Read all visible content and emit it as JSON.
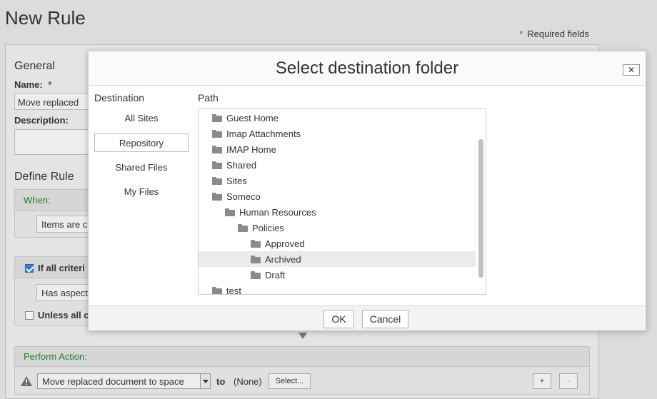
{
  "page": {
    "title": "New Rule",
    "required_note": "Required fields",
    "required_star": "*"
  },
  "general": {
    "heading": "General",
    "name_label": "Name:",
    "name_star": "*",
    "name_value": "Move replaced",
    "description_label": "Description:"
  },
  "define_rule": {
    "heading": "Define Rule",
    "when_label": "When:",
    "when_value": "Items are c",
    "if_all_label": "If all criteri",
    "if_all_checked": true,
    "has_aspect_value": "Has aspect",
    "unless_label": "Unless all c",
    "unless_checked": false
  },
  "perform_action": {
    "label": "Perform Action:",
    "action_value": "Move replaced document to space",
    "to_label": "to",
    "none_label": "(None)",
    "select_button": "Select...",
    "plus_button": "+",
    "minus_button": "-"
  },
  "dialog": {
    "title": "Select destination folder",
    "close_glyph": "✕",
    "destination_label": "Destination",
    "path_label": "Path",
    "sites": [
      {
        "label": "All Sites",
        "selected": false
      },
      {
        "label": "Repository",
        "selected": true
      },
      {
        "label": "Shared Files",
        "selected": false
      },
      {
        "label": "My Files",
        "selected": false
      }
    ],
    "tree": [
      {
        "label": "Guest Home",
        "depth": 0,
        "highlight": false
      },
      {
        "label": "Imap Attachments",
        "depth": 0,
        "highlight": false
      },
      {
        "label": "IMAP Home",
        "depth": 0,
        "highlight": false
      },
      {
        "label": "Shared",
        "depth": 0,
        "highlight": false
      },
      {
        "label": "Sites",
        "depth": 0,
        "highlight": false
      },
      {
        "label": "Someco",
        "depth": 0,
        "highlight": false
      },
      {
        "label": "Human Resources",
        "depth": 1,
        "highlight": false
      },
      {
        "label": "Policies",
        "depth": 2,
        "highlight": false
      },
      {
        "label": "Approved",
        "depth": 3,
        "highlight": false
      },
      {
        "label": "Archived",
        "depth": 3,
        "highlight": true
      },
      {
        "label": "Draft",
        "depth": 3,
        "highlight": false
      },
      {
        "label": "test",
        "depth": 0,
        "highlight": false
      }
    ],
    "ok_button": "OK",
    "cancel_button": "Cancel"
  },
  "colors": {
    "accent_green": "#2a7a2a",
    "highlight_row": "#ebebeb",
    "folder_icon": "#8a8a8a"
  }
}
